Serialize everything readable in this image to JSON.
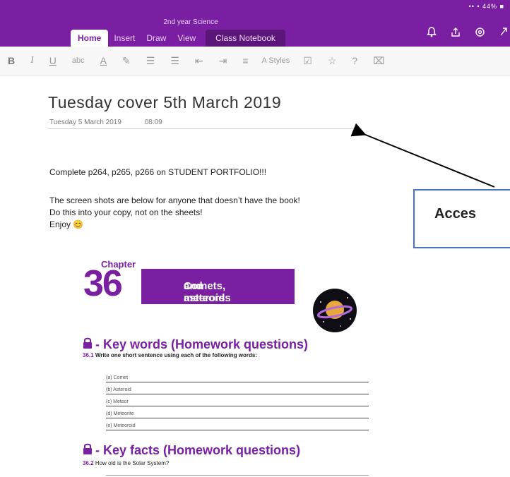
{
  "app": {
    "notebook_title": "2nd year Science",
    "status": "•• • 44% ■",
    "tabs": [
      {
        "label": "Home"
      },
      {
        "label": "Insert"
      },
      {
        "label": "Draw"
      },
      {
        "label": "View"
      },
      {
        "label": "Class Notebook"
      }
    ],
    "ribbon": {
      "bold": "B",
      "italic": "I",
      "underline": "U",
      "strike": "abc",
      "font_color": "A",
      "highlighter": "✎",
      "bullets": "☰",
      "numbering": "☰",
      "outdent": "⇤",
      "indent": "⇥",
      "align": "≡",
      "styles_glyph": "A",
      "styles": "Styles",
      "todo": "☑",
      "star": "☆",
      "help": "?",
      "tag": "⌧"
    }
  },
  "page": {
    "title": "Tuesday cover 5th March 2019",
    "date": "Tuesday 5 March 2019",
    "time": "08:09",
    "line1": "Complete p264, p265, p266 on STUDENT PORTFOLIO!!!",
    "line2": "The screen shots are below for anyone that doesn’t have the book!",
    "line3": "Do this into your copy, not on the sheets!",
    "line4": "Enjoy 😊"
  },
  "callout": {
    "label": "Acces"
  },
  "chapter": {
    "label": "Chapter",
    "number": "36",
    "title_line1": "Comets, asteroids",
    "title_line2": "and meteors",
    "keywords_heading": "- Key words (Homework questions)",
    "q1_num": "36.1",
    "q1_text": "Write one short sentence using each of the following words:",
    "words": [
      "(a)  Comet",
      "(b)  Asteroid",
      "(c)  Meteor",
      "(d)  Meteorite",
      "(e)  Meteoroid"
    ],
    "keyfacts_heading": "- Key facts (Homework questions)",
    "q2_num": "36.2",
    "q2_text": "How old is the Solar System?"
  },
  "colors": {
    "brand": "#7a1fa2",
    "callout_border": "#4a72c4"
  }
}
